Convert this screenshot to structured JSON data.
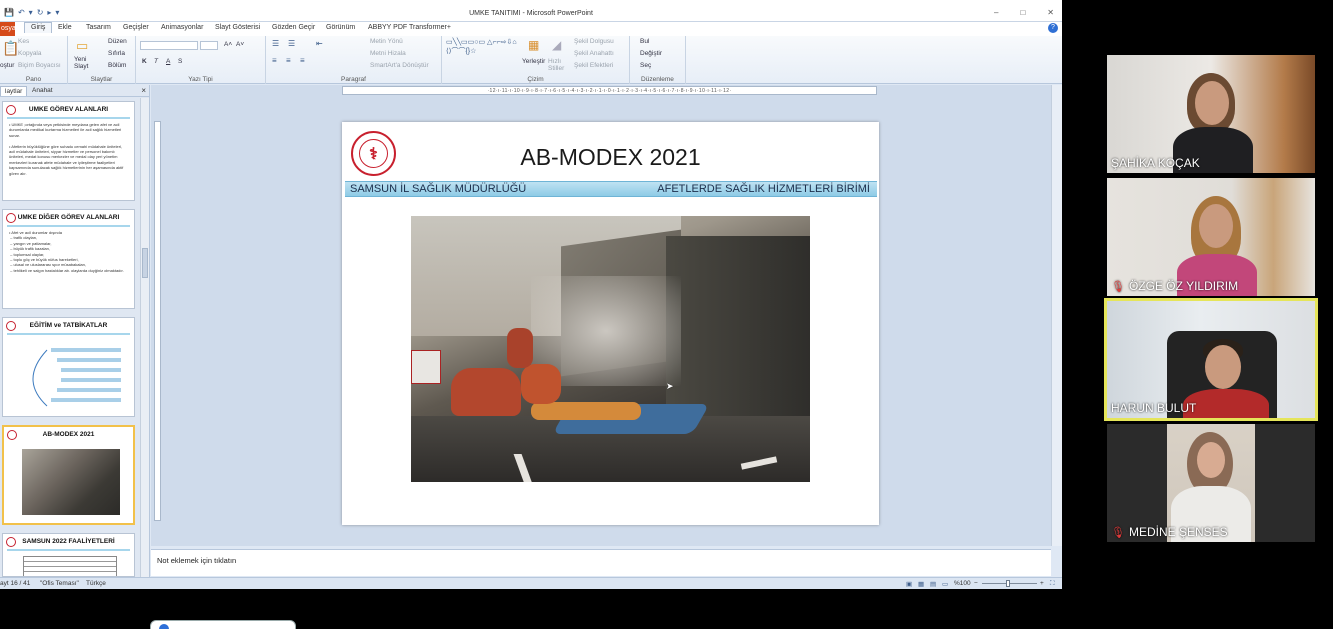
{
  "window": {
    "title": "UMKE TANITIMI - Microsoft PowerPoint",
    "qat": [
      "💾",
      "↶",
      "▾",
      "↻",
      "▸",
      "▾"
    ],
    "controls": [
      "–",
      "□",
      "✕"
    ]
  },
  "tabs": {
    "file": "osya",
    "items": [
      "Giriş",
      "Ekle",
      "Tasarım",
      "Geçişler",
      "Animasyonlar",
      "Slayt Gösterisi",
      "Gözden Geçir",
      "Görünüm",
      "ABBYY PDF Transformer+"
    ],
    "active_index": 0,
    "help": "?"
  },
  "ribbon": {
    "clipboard": {
      "label": "Pano",
      "cut": "Kes",
      "copy": "Kopyala",
      "painter": "Biçim Boyacısı",
      "paste": "oştur"
    },
    "slides": {
      "label": "Slaytlar",
      "new_slide": "Yeni Slayt",
      "layout": "Düzen",
      "reset": "Sıfırla",
      "section": "Bölüm"
    },
    "font": {
      "label": "Yazı Tipi",
      "bold": "K",
      "italic": "T",
      "underline": "A",
      "strike": "S",
      "grow": "A˄",
      "shrink": "A˅"
    },
    "paragraph": {
      "label": "Paragraf",
      "text_direction": "Metin Yönü",
      "align_text": "Metni Hizala",
      "smartart": "SmartArt'a Dönüştür"
    },
    "drawing": {
      "label": "Çizim",
      "arrange": "Yerleştir",
      "quick_styles": "Hızlı Stiller",
      "fill": "Şekil Dolgusu",
      "outline": "Şekil Anahattı",
      "effects": "Şekil Efektleri"
    },
    "editing": {
      "label": "Düzenleme",
      "find": "Bul",
      "replace": "Değiştir",
      "select": "Seç"
    }
  },
  "pane": {
    "tabs": [
      "laytlar",
      "Anahat"
    ],
    "close": "×",
    "slides": [
      {
        "num": "13",
        "title": "UMKE GÖREV ALANLARI",
        "body": "• UMKE ;ortağında veya yetkisinde meydana gelen afet ve acil durumlarda medikal kurtarma hizmetleri ile acil sağlık hizmetleri sunar.\n\n• Afetlerin büyüklüğüne göre suhadu cemahi müdahale ünitelerl, acil müdahale üniteleri, siyyar hizmetler ve personel bakımlı üniteleri, medat konusu merkezler ve medal olay yeri yönetim merkezleri kuranak afete müdahale ve iyileştirme faaliyetleri kapsamında sunulacak sağlık hizmetlerinin her aşamasında aktif görev alır."
      },
      {
        "num": "14",
        "title": "UMKE DİĞER GÖREV ALANLARI",
        "body": "• Afet ve acil durumlar dışında\n – trafik olayları,\n – yangın ve patlamalar,\n – büyük trafik kazaları,\n – toplumsal olaylar,\n – toplu göç ve büyük nüfus hareketleri,\n – ulusal ve uluslararası spor müsabakaları,\n – tehlikeli ve salgın hastalıklar ab. olaylarda duyğiniz olmaktadır."
      },
      {
        "num": "15",
        "title": "EĞİTİM ve TATBİKATLAR",
        "body": ""
      },
      {
        "num": "16",
        "title": "AB-MODEX 2021",
        "body": ""
      },
      {
        "num": "17",
        "title": "SAMSUN 2022 FAALİYETLERİ",
        "body": ""
      }
    ]
  },
  "ruler": "·12·ı·11·ı·10·ı·9·ı·8·ı·7·ı·6·ı·5·ı·4·ı·3·ı·2·ı·1·ı·0·ı·1·ı·2·ı·3·ı·4·ı·5·ı·6·ı·7·ı·8·ı·9·ı·10·ı·11·ı·12·",
  "slide": {
    "title": "AB-MODEX 2021",
    "band_left": "SAMSUN İL SAĞLIK MÜDÜRLÜĞÜ",
    "band_right": "AFETLERDE SAĞLIK HİZMETLERİ BİRİMİ",
    "logo_glyph": "⚕"
  },
  "notes": {
    "placeholder": "Not eklemek için tıklatın"
  },
  "status": {
    "slide_counter": "ayt 16 / 41",
    "theme": "\"Ofis Teması\"",
    "language": "Türkçe",
    "zoom": "%100",
    "zoom_minus": "−",
    "zoom_plus": "+"
  },
  "participants": [
    {
      "name": "ŞAHİKA KOÇAK",
      "muted": false,
      "active": false
    },
    {
      "name": "ÖZGE ÖZ YILDIRIM",
      "muted": true,
      "active": false
    },
    {
      "name": "HARUN BULUT",
      "muted": false,
      "active": true
    },
    {
      "name": "MEDİNE ŞENSES",
      "muted": true,
      "active": false
    }
  ],
  "mic_muted_icon": "🎙"
}
